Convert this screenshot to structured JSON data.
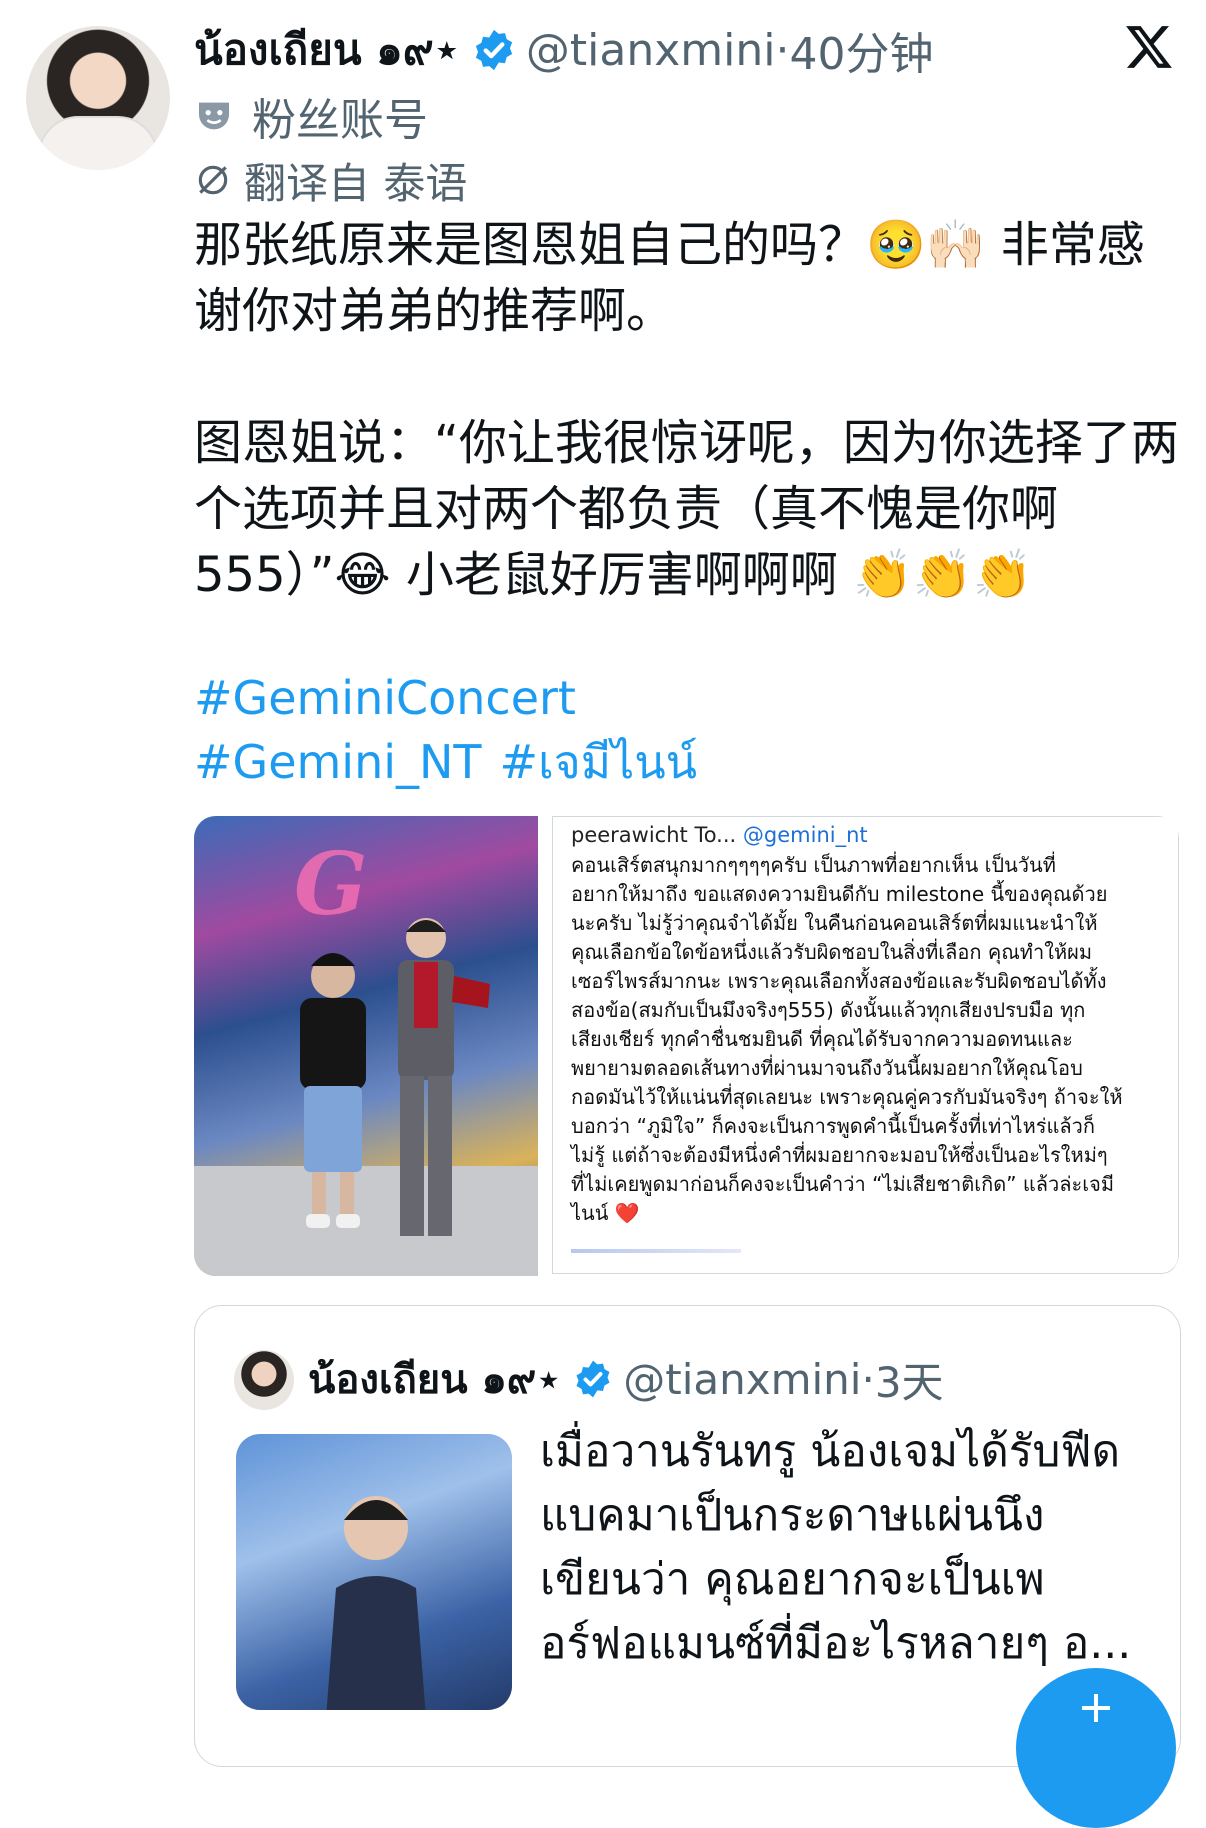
{
  "post": {
    "author_name": "น้องเถียน ๑๙⋆",
    "handle": "@tianxmini",
    "separator": "·",
    "time": "40分钟",
    "account_label": "粉丝账号",
    "translated_label": "翻译自 泰语",
    "body": "那张纸原来是图恩姐自己的吗？🥹🙌🏻 非常感\n谢你对弟弟的推荐啊。\n\n图恩姐说：“你让我很惊讶呢，因为你选择了两\n个选项并且对两个都负责（真不愧是你啊\n555）”😂 小老鼠好厉害啊啊啊 👏👏👏",
    "hashtags": [
      "#GeminiConcert",
      "#Gemini_NT",
      "#เจมีไนน์"
    ]
  },
  "note_card": {
    "header_author": "peerawicht To...",
    "header_mention": "@gemini_nt",
    "text": "คอนเสิร์ตสนุกมากๆๆๆๆครับ เป็นภาพที่อยากเห็น เป็นวันที่\nอยากให้มาถึง ขอแสดงความยินดีกับ milestone นี้ของคุณด้วย\nนะครับ ไม่รู้ว่าคุณจำได้มั้ย ในคืนก่อนคอนเสิร์ตที่ผมแนะนำให้\nคุณเลือกข้อใดข้อหนึ่งแล้วรับผิดชอบในสิ่งที่เลือก คุณทำให้ผม\nเซอร์ไพรส์มากนะ เพราะคุณเลือกทั้งสองข้อและรับผิดชอบได้ทั้ง\nสองข้อ(สมกับเป็นมึงจริงๆ555) ดังนั้นแล้วทุกเสียงปรบมือ ทุก\nเสียงเชียร์ ทุกคำชื่นชมยินดี ที่คุณได้รับจากความอดทนและ\nพยายามตลอดเส้นทางที่ผ่านมาจนถึงวันนี้ผมอยากให้คุณโอบ\nกอดมันไว้ให้แน่นที่สุดเลยนะ เพราะคุณคู่ควรกับมันจริงๆ ถ้าจะให้\nบอกว่า “ภูมิใจ” ก็คงจะเป็นการพูดคำนี้เป็นครั้งที่เท่าไหร่แล้วก็\nไม่รู้ แต่ถ้าจะต้องมีหนึ่งคำที่ผมอยากจะมอบให้ซึ่งเป็นอะไรใหม่ๆ\nที่ไม่เคยพูดมาก่อนก็คงจะเป็นคำว่า “ไม่เสียชาติเกิด” แล้วล่ะเจมี\nไนน์ ❤️"
  },
  "quoted": {
    "author_name": "น้องเถียน ๑๙⋆",
    "handle": "@tianxmini",
    "separator": "·",
    "time": "3天",
    "text": "เมื่อวานรันทรู น้องเจมได้รับฟีด\nแบคมาเป็นกระดาษแผ่นนึง\nเขียนว่า คุณอยากจะเป็นเพ\nอร์ฟอแมนซ์ที่มีอะไรหลายๆ อ..."
  },
  "colors": {
    "link": "#1d9bf0",
    "muted": "#536471",
    "border": "#cfd9de"
  },
  "icons": [
    "verified-badge-icon",
    "x-logo-icon",
    "fan-mask-icon",
    "translate-icon",
    "compose-fab-icon"
  ]
}
